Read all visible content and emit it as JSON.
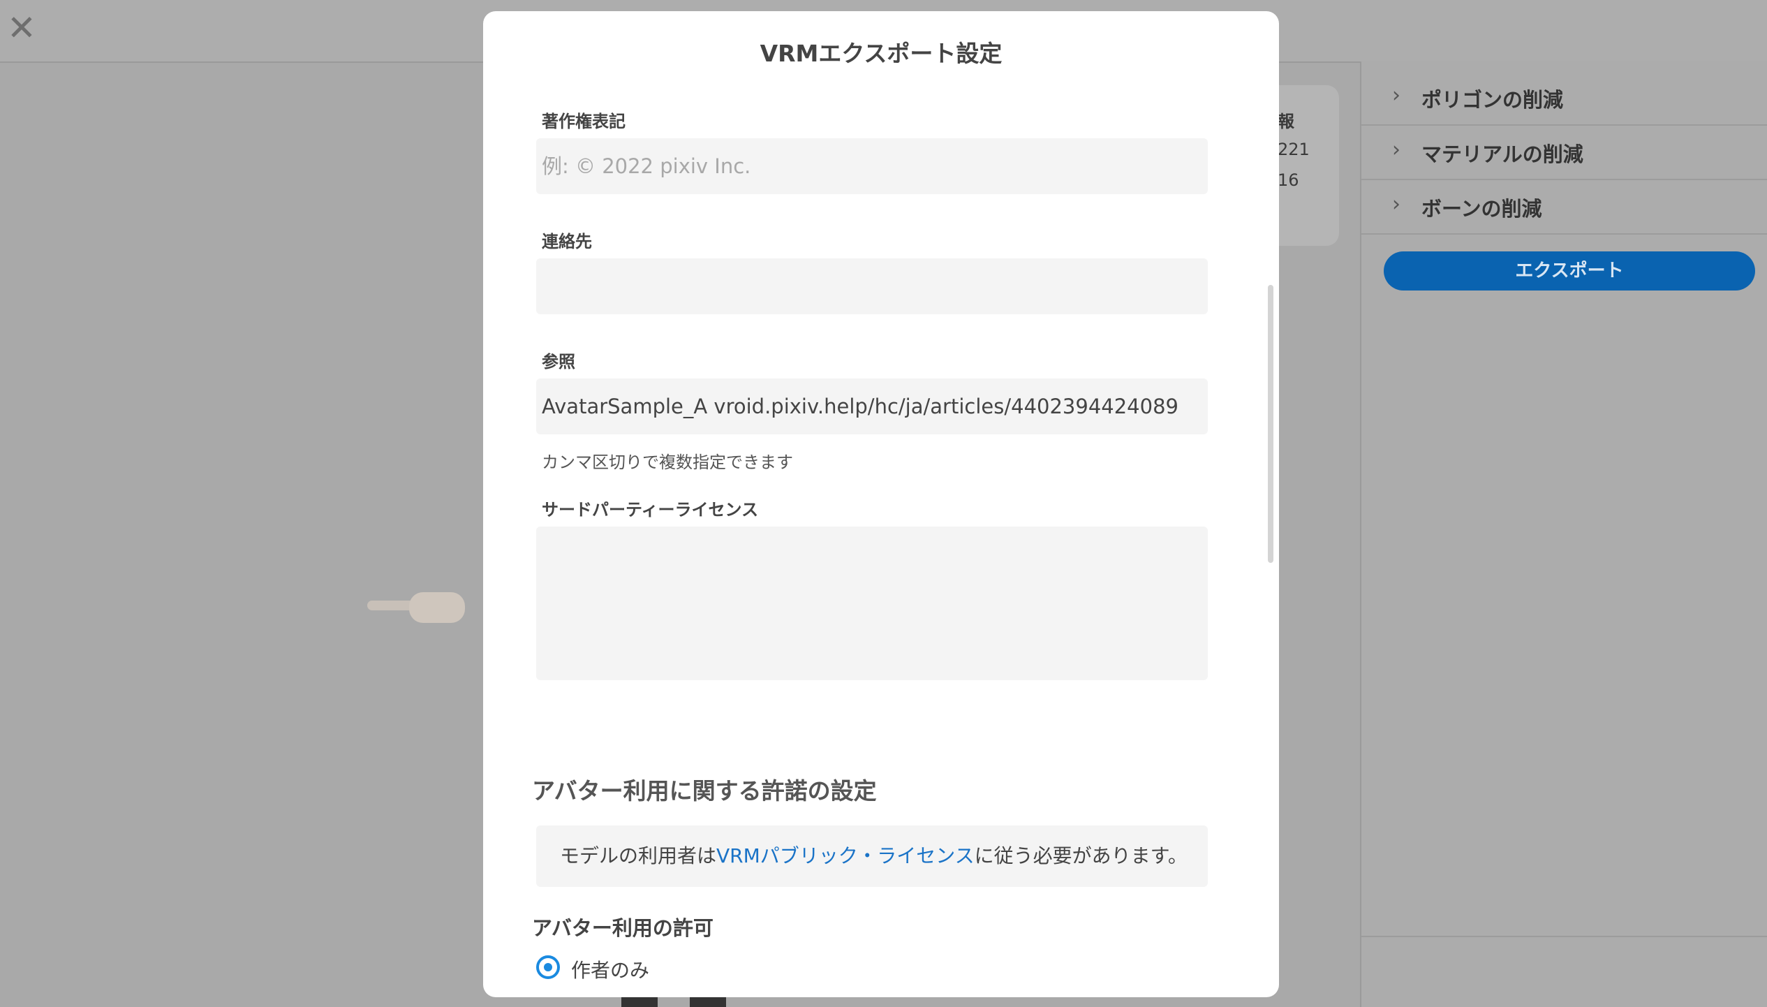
{
  "modal": {
    "title": "VRMエクスポート設定",
    "copyright": {
      "label": "著作権表記",
      "placeholder": "例: © 2022 pixiv Inc."
    },
    "contact": {
      "label": "連絡先",
      "value": ""
    },
    "reference": {
      "label": "参照",
      "value": "AvatarSample_A vroid.pixiv.help/hc/ja/articles/4402394424089",
      "hint": "カンマ区切りで複数指定できます"
    },
    "third_party": {
      "label": "サードパーティーライセンス",
      "value": ""
    },
    "permission_section_title": "アバター利用に関する許諾の設定",
    "license_notice": {
      "prefix": "モデルの利用者は",
      "link": "VRMパブリック・ライセンス",
      "suffix": "に従う必要があります。"
    },
    "avatar_permission": {
      "title": "アバター利用の許可",
      "options": [
        {
          "label": "作者のみ",
          "selected": true
        }
      ]
    }
  },
  "background_info": {
    "line1": "報",
    "line2": "221",
    "line3": "16"
  },
  "right_panel": {
    "items": [
      {
        "label": "ポリゴンの削減"
      },
      {
        "label": "マテリアルの削減"
      },
      {
        "label": "ボーンの削減"
      }
    ],
    "export_button": "エクスポート"
  },
  "colors": {
    "accent": "#1a8ae0",
    "export_button": "#0a63b0",
    "link": "#1a73c7"
  }
}
